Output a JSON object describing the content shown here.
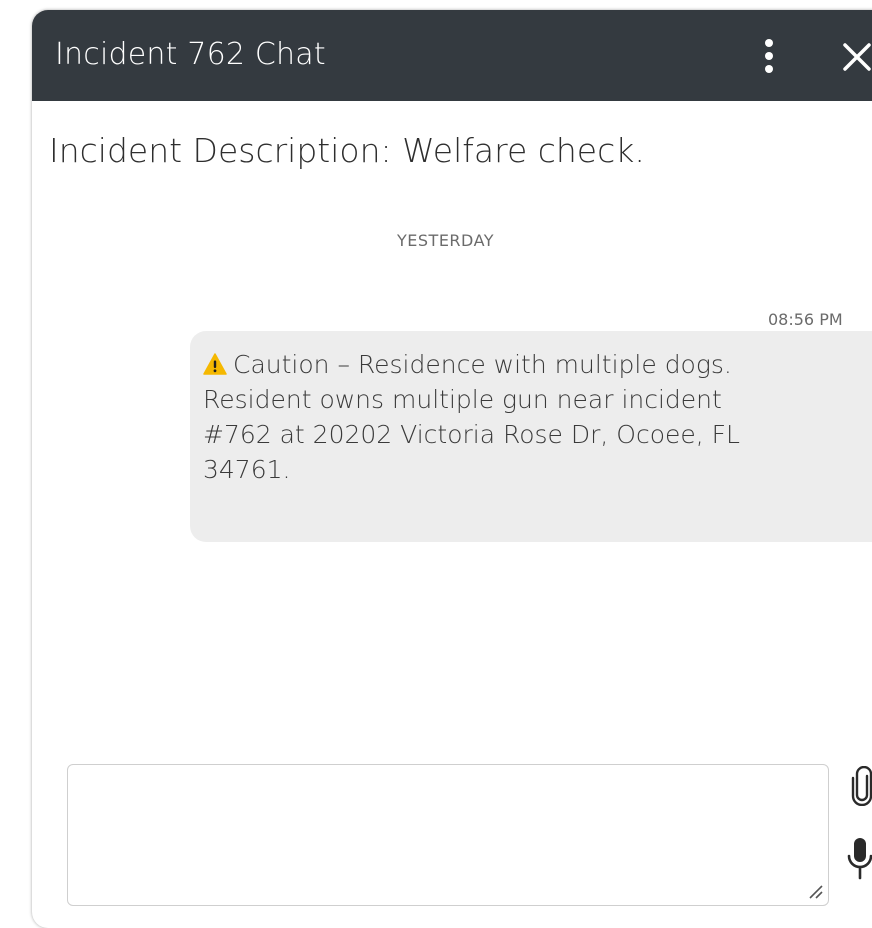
{
  "window": {
    "title": "Incident 762 Chat",
    "icons": {
      "menu": "more-vertical-icon",
      "close": "close-icon"
    }
  },
  "chat": {
    "description": "Incident Description: Welfare check.",
    "day_divider": "YESTERDAY",
    "messages": [
      {
        "time": "08:56 PM",
        "icon": "warning-icon",
        "text": "Caution – Residence with multiple dogs.\nResident owns multiple gun near incident\n#762 at 20202 Victoria Rose Dr, Ocoee, FL\n34761."
      }
    ]
  },
  "composer": {
    "value": "",
    "placeholder": "",
    "icons": {
      "attach": "paperclip-icon",
      "mic": "microphone-icon"
    }
  },
  "colors": {
    "titlebar": "#343a40",
    "bubble": "#ededed",
    "warning": "#f5b800"
  }
}
